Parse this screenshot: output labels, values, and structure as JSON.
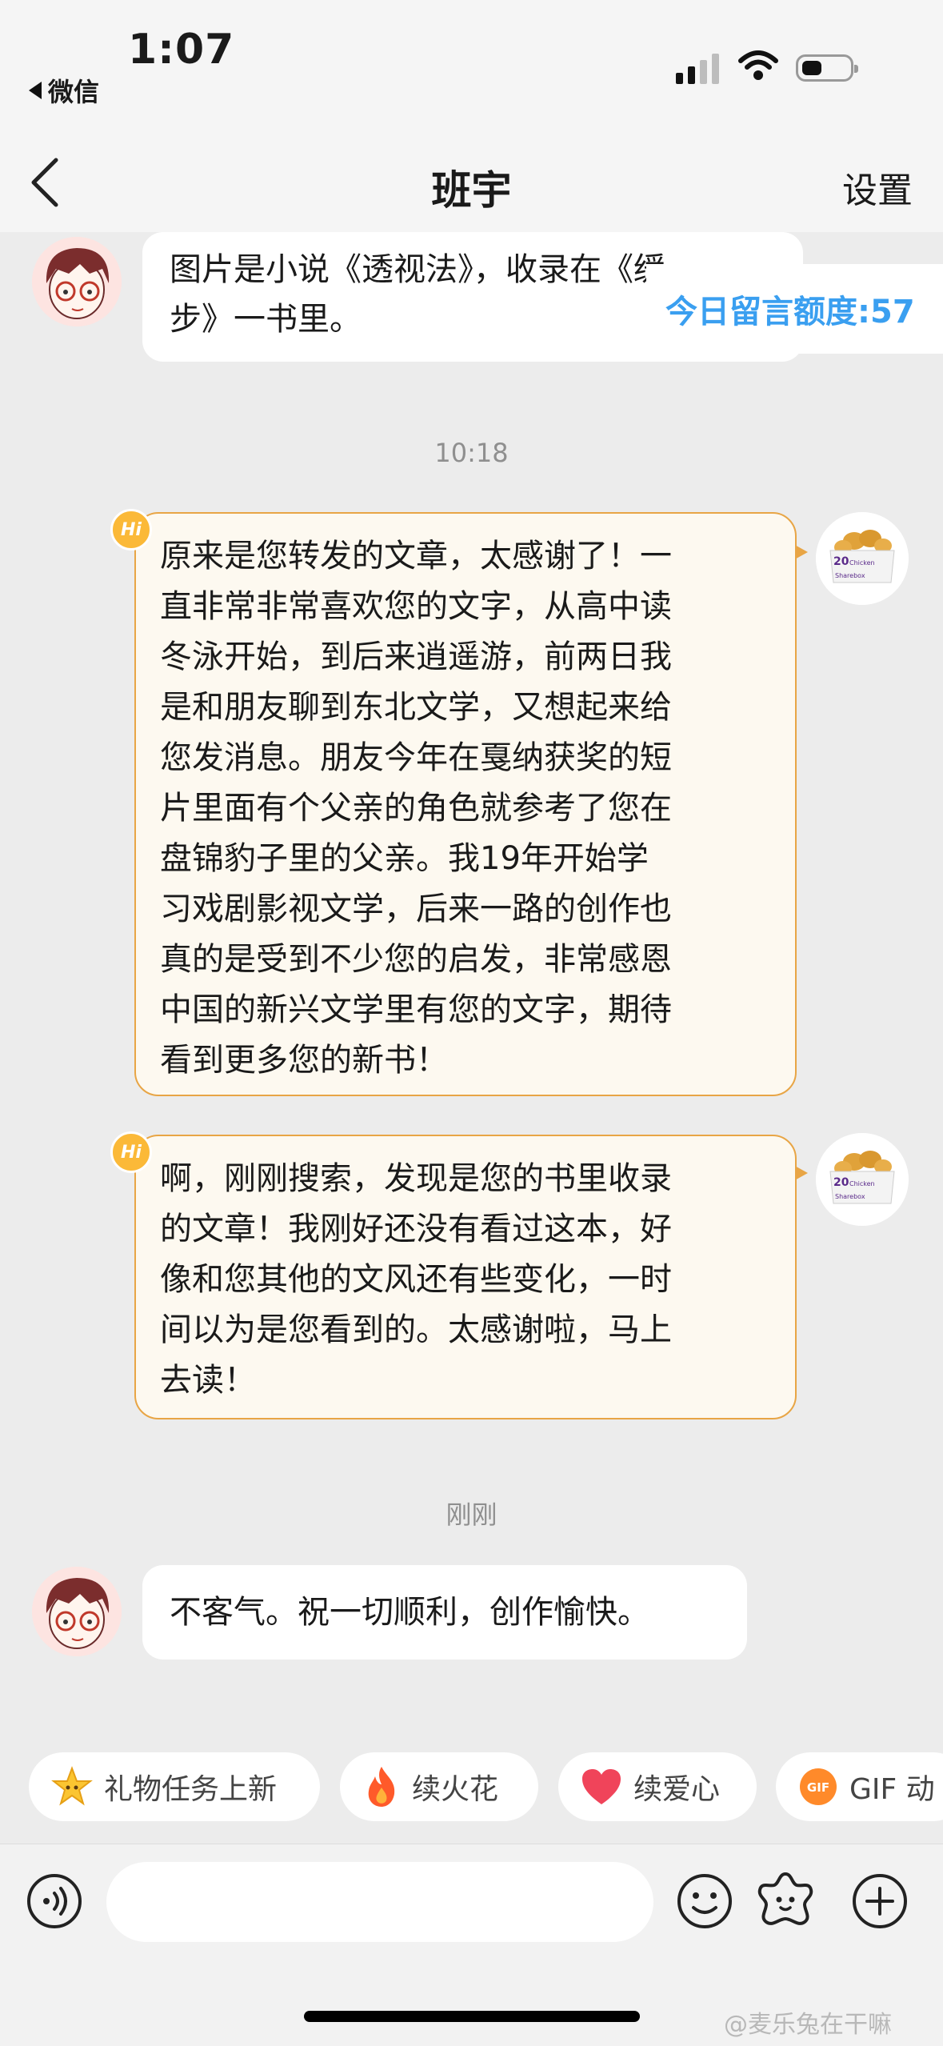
{
  "status_bar": {
    "time": "1:07",
    "back_app": "微信"
  },
  "nav": {
    "title": "班宇",
    "settings": "设置"
  },
  "quota_badge": "今日留言额度:57",
  "messages": [
    {
      "side": "left",
      "text_line1": "图片是小说《透视法》，收录在《缓",
      "text_line2": "步》一书里。"
    },
    {
      "timestamp": "10:18"
    },
    {
      "side": "right",
      "badge": "Hi",
      "lines": [
        "原来是您转发的文章，太感谢了！一",
        "直非常非常喜欢您的文字，从高中读",
        "冬泳开始，到后来逍遥游，前两日我",
        "是和朋友聊到东北文学，又想起来给",
        "您发消息。朋友今年在戛纳获奖的短",
        "片里面有个父亲的角色就参考了您在",
        "盘锦豹子里的父亲。我19年开始学",
        "习戏剧影视文学，后来一路的创作也",
        "真的是受到不少您的启发，非常感恩",
        "中国的新兴文学里有您的文字，期待",
        "看到更多您的新书！"
      ]
    },
    {
      "side": "right",
      "badge": "Hi",
      "lines": [
        "啊，刚刚搜索，发现是您的书里收录",
        "的文章！我刚好还没有看过这本，好",
        "像和您其他的文风还有些变化，一时",
        "间以为是您看到的。太感谢啦，马上",
        "去读！"
      ]
    },
    {
      "timestamp": "刚刚"
    },
    {
      "side": "left",
      "text": "不客气。祝一切顺利，创作愉快。"
    }
  ],
  "chips": [
    {
      "label": "礼物任务上新",
      "icon": "star-icon"
    },
    {
      "label": "续火花",
      "icon": "fire-icon"
    },
    {
      "label": "续爱心",
      "icon": "heart-icon"
    },
    {
      "label": "GIF 动",
      "icon": "gif-icon",
      "icon_text": "GIF"
    }
  ],
  "avatar_right_text": {
    "num": "20",
    "brand": "Chicken",
    "sub": "Sharebox"
  },
  "watermark": "@麦乐兔在干嘛"
}
